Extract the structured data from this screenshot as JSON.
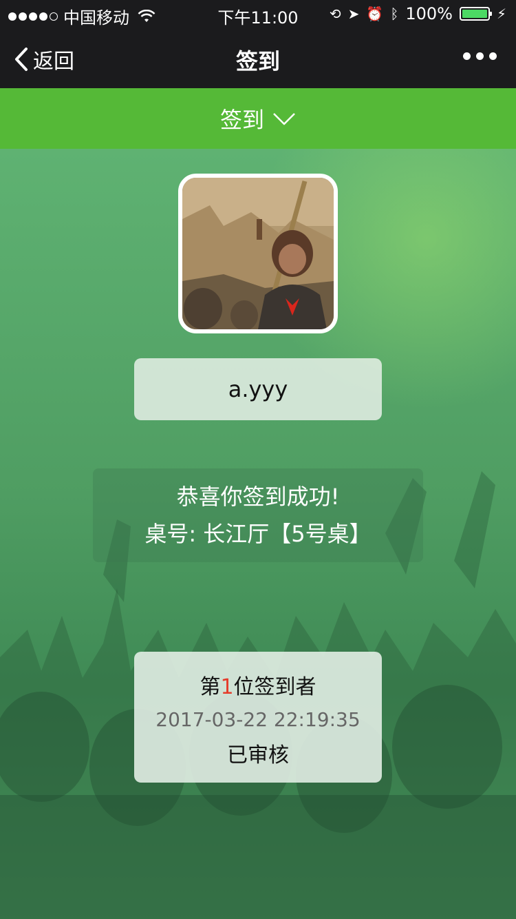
{
  "status_bar": {
    "carrier": "中国移动",
    "time": "下午11:00",
    "battery": "100%"
  },
  "nav": {
    "back_label": "返回",
    "title": "签到"
  },
  "sub_header": {
    "label": "签到"
  },
  "user": {
    "name": "a.yyy"
  },
  "success": {
    "message": "恭喜你签到成功!",
    "table": "桌号: 长江厅【5号桌】"
  },
  "rank": {
    "prefix": "第",
    "number": "1",
    "suffix": "位签到者",
    "timestamp": "2017-03-22 22:19:35",
    "status": "已审核"
  },
  "colors": {
    "accent_green": "#55b937",
    "rank_red": "#e53b2a"
  }
}
